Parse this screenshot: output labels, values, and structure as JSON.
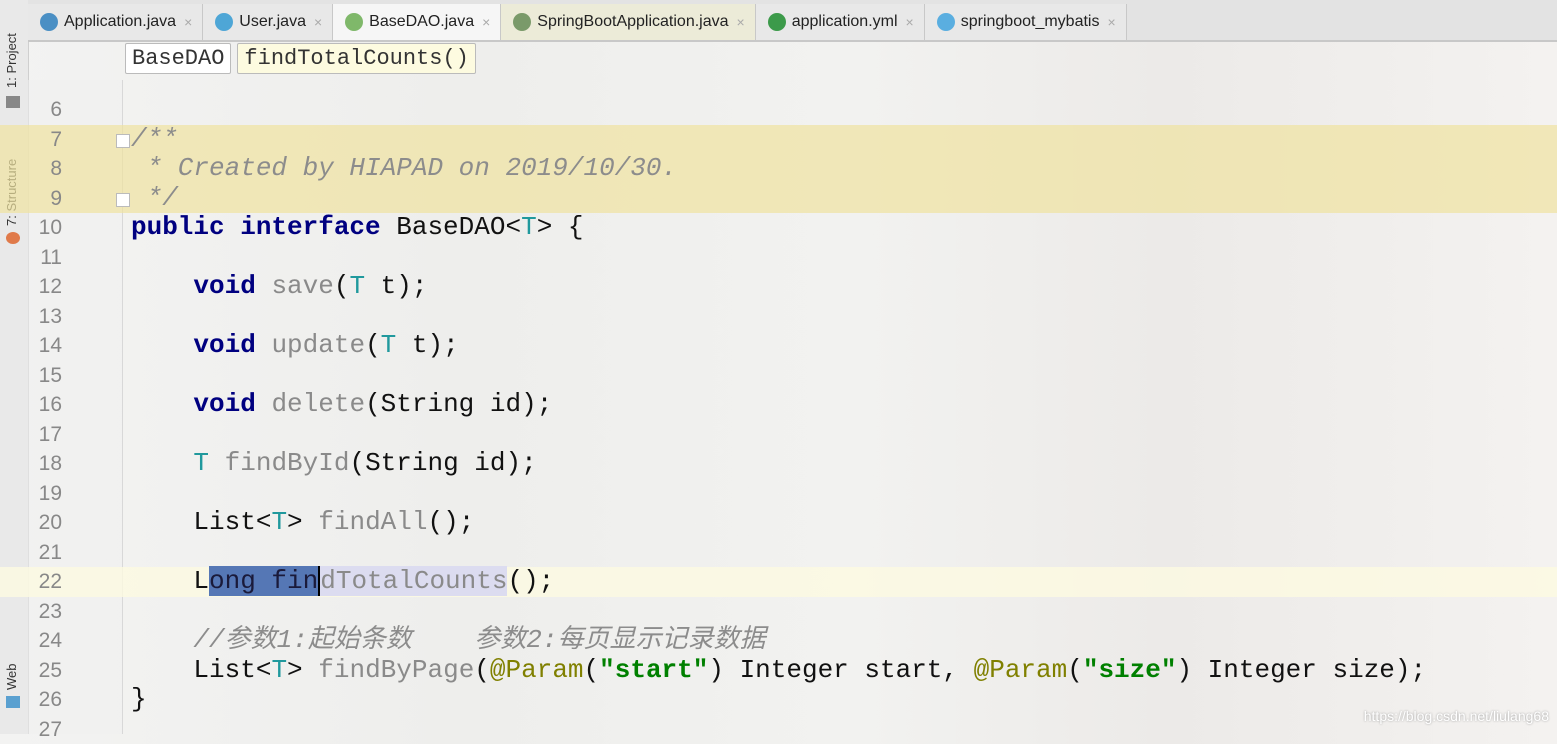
{
  "sidebar": {
    "project": "1: Project",
    "structure": "7: Structure",
    "web": "Web"
  },
  "tabs": [
    {
      "label": "Application.java",
      "icon": "spring-boot-app-icon",
      "color": "#4a8fc4",
      "state": "normal"
    },
    {
      "label": "User.java",
      "icon": "class-c-icon",
      "color": "#4ea6d6",
      "state": "normal"
    },
    {
      "label": "BaseDAO.java",
      "icon": "interface-i-icon",
      "color": "#7fb86a",
      "state": "active"
    },
    {
      "label": "SpringBootApplication.java",
      "icon": "annotation-icon",
      "color": "#7a9a6a",
      "state": "spring"
    },
    {
      "label": "application.yml",
      "icon": "spring-leaf-icon",
      "color": "#3c9a4a",
      "state": "normal"
    },
    {
      "label": "springboot_mybatis",
      "icon": "maven-m-icon",
      "color": "#5aaee0",
      "state": "normal"
    }
  ],
  "tab_close": "×",
  "breadcrumb": {
    "class": "BaseDAO",
    "method": "findTotalCounts()"
  },
  "code": [
    {
      "n": "6",
      "t": []
    },
    {
      "n": "7",
      "doc": true,
      "fold": true,
      "t": [
        [
          "cm",
          "/**"
        ]
      ]
    },
    {
      "n": "8",
      "doc": true,
      "t": [
        [
          "cm",
          " * Created by HIAPAD on 2019/10/30."
        ]
      ]
    },
    {
      "n": "9",
      "doc": true,
      "fold": true,
      "t": [
        [
          "cm",
          " */"
        ]
      ]
    },
    {
      "n": "10",
      "t": [
        [
          "kw",
          "public interface "
        ],
        [
          "",
          "BaseDAO<"
        ],
        [
          "tp",
          "T"
        ],
        [
          "",
          "> {"
        ]
      ]
    },
    {
      "n": "11",
      "t": []
    },
    {
      "n": "12",
      "t": [
        [
          "",
          "    "
        ],
        [
          "kw",
          "void "
        ],
        [
          "fn",
          "save"
        ],
        [
          "",
          "("
        ],
        [
          "tp",
          "T"
        ],
        [
          "",
          " t);"
        ]
      ]
    },
    {
      "n": "13",
      "t": []
    },
    {
      "n": "14",
      "t": [
        [
          "",
          "    "
        ],
        [
          "kw",
          "void "
        ],
        [
          "fn",
          "update"
        ],
        [
          "",
          "("
        ],
        [
          "tp",
          "T"
        ],
        [
          "",
          " t);"
        ]
      ]
    },
    {
      "n": "15",
      "t": []
    },
    {
      "n": "16",
      "t": [
        [
          "",
          "    "
        ],
        [
          "kw",
          "void "
        ],
        [
          "fn",
          "delete"
        ],
        [
          "",
          "(String id);"
        ]
      ]
    },
    {
      "n": "17",
      "t": []
    },
    {
      "n": "18",
      "t": [
        [
          "",
          "    "
        ],
        [
          "tp",
          "T "
        ],
        [
          "fn",
          "findById"
        ],
        [
          "",
          "(String id);"
        ]
      ]
    },
    {
      "n": "19",
      "t": []
    },
    {
      "n": "20",
      "t": [
        [
          "",
          "    List<"
        ],
        [
          "tp",
          "T"
        ],
        [
          "",
          "> "
        ],
        [
          "fn",
          "findAll"
        ],
        [
          "",
          "();"
        ]
      ]
    },
    {
      "n": "21",
      "t": []
    },
    {
      "n": "22",
      "cur": true,
      "t": [
        [
          "",
          "    L"
        ],
        [
          "sel",
          "ong fin"
        ],
        [
          "hl caret fn",
          "dTotalCounts"
        ],
        [
          "",
          "();"
        ]
      ]
    },
    {
      "n": "23",
      "t": []
    },
    {
      "n": "24",
      "t": [
        [
          "",
          "    "
        ],
        [
          "cm",
          "//参数1:起始条数    参数2:每页显示记录数据"
        ]
      ]
    },
    {
      "n": "25",
      "t": [
        [
          "",
          "    List<"
        ],
        [
          "tp",
          "T"
        ],
        [
          "",
          "> "
        ],
        [
          "fn",
          "findByPage"
        ],
        [
          "",
          "("
        ],
        [
          "an",
          "@Param"
        ],
        [
          "",
          "("
        ],
        [
          "st",
          "\"start\""
        ],
        [
          "",
          ") Integer start, "
        ],
        [
          "an",
          "@Param"
        ],
        [
          "",
          "("
        ],
        [
          "st",
          "\"size\""
        ],
        [
          "",
          ") Integer size);"
        ]
      ]
    },
    {
      "n": "26",
      "t": [
        [
          "",
          "}"
        ]
      ]
    },
    {
      "n": "27",
      "t": []
    }
  ],
  "watermark": "https://blog.csdn.net/liulang68"
}
